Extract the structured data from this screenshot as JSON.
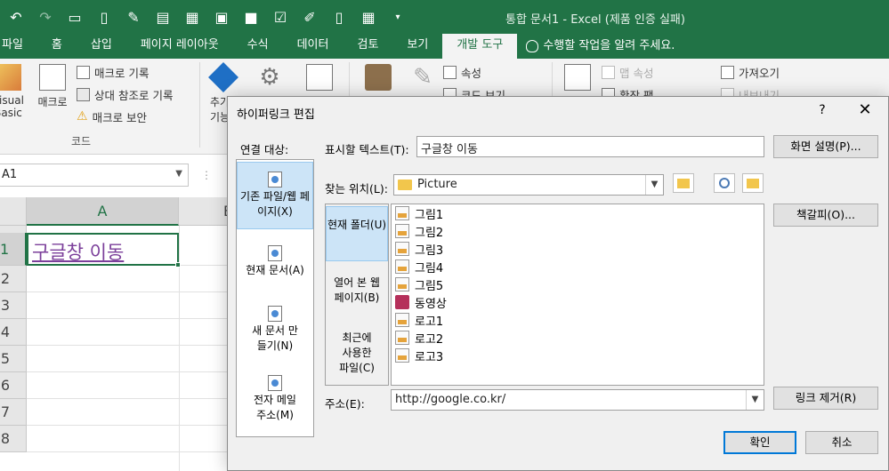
{
  "app": {
    "window_title": "통합 문서1 - Excel (제품 인증 실패)"
  },
  "tabs": [
    {
      "label": "파일"
    },
    {
      "label": "홈"
    },
    {
      "label": "삽입"
    },
    {
      "label": "페이지 레이아웃"
    },
    {
      "label": "수식"
    },
    {
      "label": "데이터"
    },
    {
      "label": "검토"
    },
    {
      "label": "보기"
    },
    {
      "label": "개발 도구",
      "active": true
    },
    {
      "label": "수행할 작업을 알려 주세요."
    }
  ],
  "ribbon": {
    "visual_basic": "Visual Basic",
    "macro": "매크로",
    "record_macro": "매크로 기록",
    "relative_ref": "상대 참조로 기록",
    "macro_security": "매크로 보안",
    "group_code": "코드",
    "add": "추가",
    "add2": "기능",
    "properties": "속성",
    "view_code": "코드 보기",
    "map_properties": "맵 속성",
    "expansion_pack": "확장 팩",
    "import": "가져오기",
    "export": "내보내기"
  },
  "formula_bar": {
    "name_box": "A1"
  },
  "grid": {
    "columns": [
      "A",
      "B"
    ],
    "rows": [
      "1",
      "2",
      "3",
      "4",
      "5",
      "6",
      "7",
      "8"
    ],
    "a1_value": "구글창 이동"
  },
  "dialog": {
    "title": "하이퍼링크 편집",
    "help": "?",
    "close": "✕",
    "link_to_label": "연결 대상:",
    "link_to": [
      {
        "label": "기존 파일/웹 페이지(X)",
        "selected": true
      },
      {
        "label": "현재 문서(A)"
      },
      {
        "label": "새 문서 만들기(N)"
      },
      {
        "label": "전자 메일 주소(M)"
      }
    ],
    "display_text_label": "표시할 텍스트(T):",
    "display_text_value": "구글창 이동",
    "screentip_button": "화면 설명(P)...",
    "look_in_label": "찾는 위치(L):",
    "look_in_value": "Picture",
    "bookmark_button": "책갈피(O)...",
    "side_tabs": [
      {
        "label": "현재 폴더(U)",
        "selected": true
      },
      {
        "label": "열어 본 웹 페이지(B)"
      },
      {
        "label": "최근에 사용한 파일(C)"
      }
    ],
    "files": [
      {
        "name": "그림1",
        "type": "jpg"
      },
      {
        "name": "그림2",
        "type": "jpg"
      },
      {
        "name": "그림3",
        "type": "jpg"
      },
      {
        "name": "그림4",
        "type": "jpg"
      },
      {
        "name": "그림5",
        "type": "jpg"
      },
      {
        "name": "동영상",
        "type": "video"
      },
      {
        "name": "로고1",
        "type": "jpg"
      },
      {
        "name": "로고2",
        "type": "jpg"
      },
      {
        "name": "로고3",
        "type": "jpg"
      }
    ],
    "address_label": "주소(E):",
    "address_value": "http://google.co.kr/",
    "remove_link_button": "링크 제거(R)",
    "ok_button": "확인",
    "cancel_button": "취소"
  },
  "colors": {
    "excel_green": "#217346",
    "link_purple": "#7b3f9a",
    "selection_blue": "#cce4f7"
  }
}
